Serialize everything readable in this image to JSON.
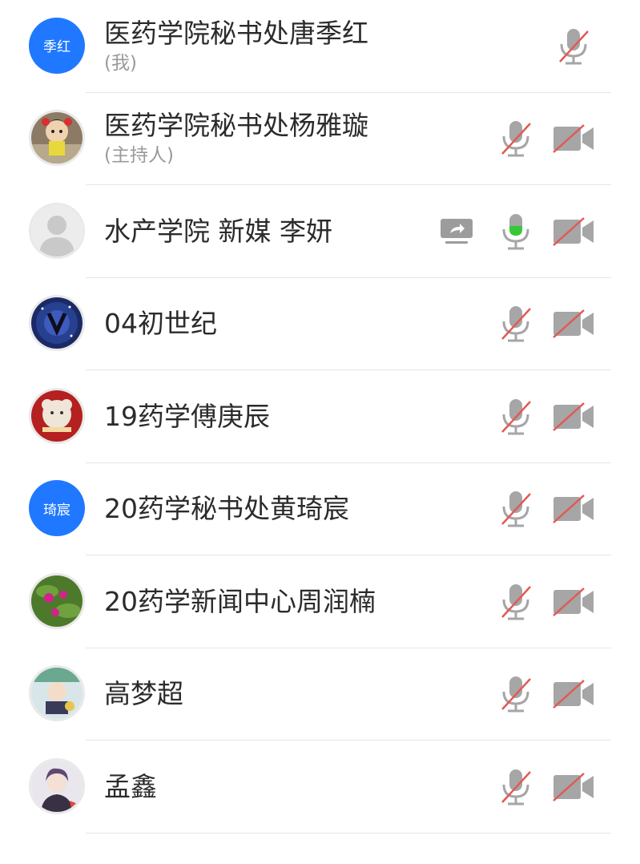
{
  "participants": [
    {
      "name": "医药学院秘书处唐季红",
      "sub": "(我)",
      "avatar_text": "季红",
      "avatar": "text",
      "mic": "off",
      "camera": "none",
      "share": false
    },
    {
      "name": "医药学院秘书处杨雅璇",
      "sub": "(主持人)",
      "avatar": "cartoon-photo",
      "mic": "off",
      "camera": "off",
      "share": false
    },
    {
      "name": "水产学院 新媒 李妍",
      "sub": "",
      "avatar": "default-silhouette",
      "mic": "on",
      "camera": "off",
      "share": true
    },
    {
      "name": "04初世纪",
      "sub": "",
      "avatar": "galaxy-photo",
      "mic": "off",
      "camera": "off",
      "share": false
    },
    {
      "name": "19药学傅庚辰",
      "sub": "",
      "avatar": "plush-toy-photo",
      "mic": "off",
      "camera": "off",
      "share": false
    },
    {
      "name": "20药学秘书处黄琦宸",
      "sub": "",
      "avatar_text": "琦宸",
      "avatar": "text",
      "mic": "off",
      "camera": "off",
      "share": false
    },
    {
      "name": "20药学新闻中心周润楠",
      "sub": "",
      "avatar": "flower-photo",
      "mic": "off",
      "camera": "off",
      "share": false
    },
    {
      "name": "高梦超",
      "sub": "",
      "avatar": "anime-photo",
      "mic": "off",
      "camera": "off",
      "share": false
    },
    {
      "name": "孟鑫",
      "sub": "",
      "avatar": "anime-boy-photo",
      "mic": "off",
      "camera": "off",
      "share": false
    }
  ],
  "colors": {
    "avatar_blue": "#1f78ff",
    "mic_active_green": "#37c837",
    "mute_slash_red": "#e05a55",
    "icon_gray": "#9c9c9c"
  }
}
